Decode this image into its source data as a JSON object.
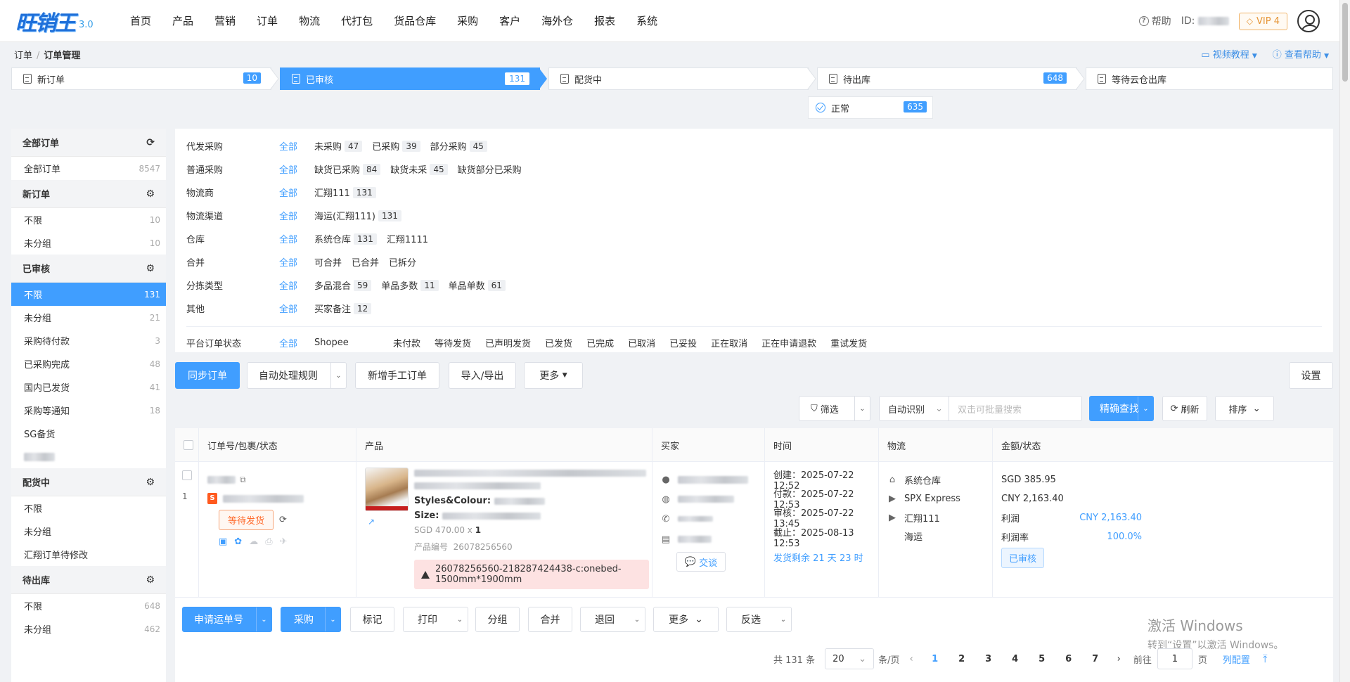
{
  "app": {
    "logo": "旺销王",
    "version": "3.0"
  },
  "nav": [
    "首页",
    "产品",
    "营销",
    "订单",
    "物流",
    "代打包",
    "货品仓库",
    "采购",
    "客户",
    "海外仓",
    "报表",
    "系统"
  ],
  "top_right": {
    "help": "帮助",
    "id_label": "ID:",
    "vip": "VIP 4"
  },
  "breadcrumb": {
    "parent": "订单",
    "current": "订单管理"
  },
  "bc_links": {
    "video": "视频教程",
    "help": "查看帮助"
  },
  "stages": [
    {
      "label": "新订单",
      "count": "10"
    },
    {
      "label": "已审核",
      "count": "131"
    },
    {
      "label": "配货中",
      "count": ""
    },
    {
      "label": "待出库",
      "count": "648"
    },
    {
      "label": "等待云仓出库",
      "count": ""
    }
  ],
  "sub_stage": {
    "label": "正常",
    "count": "635"
  },
  "sidebar": {
    "groups": [
      {
        "title": "全部订单",
        "icon": "refresh-icon",
        "items": [
          {
            "label": "全部订单",
            "count": "8547"
          }
        ]
      },
      {
        "title": "新订单",
        "icon": "gear-icon",
        "items": [
          {
            "label": "不限",
            "count": "10"
          },
          {
            "label": "未分组",
            "count": "10"
          }
        ]
      },
      {
        "title": "已审核",
        "icon": "gear-icon",
        "items": [
          {
            "label": "不限",
            "count": "131"
          },
          {
            "label": "未分组",
            "count": "21"
          },
          {
            "label": "采购待付款",
            "count": "3"
          },
          {
            "label": "已采购完成",
            "count": "48"
          },
          {
            "label": "国内已发货",
            "count": "41"
          },
          {
            "label": "采购等通知",
            "count": "18"
          },
          {
            "label": "SG备货",
            "count": ""
          }
        ]
      },
      {
        "title": "配货中",
        "icon": "gear-icon",
        "items": [
          {
            "label": "不限",
            "count": ""
          },
          {
            "label": "未分组",
            "count": ""
          },
          {
            "label": "汇翔订单待修改",
            "count": ""
          }
        ]
      },
      {
        "title": "待出库",
        "icon": "gear-icon",
        "items": [
          {
            "label": "不限",
            "count": "648"
          },
          {
            "label": "未分组",
            "count": "462"
          }
        ]
      }
    ]
  },
  "filters": {
    "all": "全部",
    "rows": [
      {
        "label": "代发采购",
        "opts": [
          {
            "t": "未采购",
            "c": "47"
          },
          {
            "t": "已采购",
            "c": "39"
          },
          {
            "t": "部分采购",
            "c": "45"
          }
        ]
      },
      {
        "label": "普通采购",
        "opts": [
          {
            "t": "缺货已采购",
            "c": "84"
          },
          {
            "t": "缺货未采",
            "c": "45"
          },
          {
            "t": "缺货部分已采购",
            "c": ""
          }
        ]
      },
      {
        "label": "物流商",
        "opts": [
          {
            "t": "汇翔111",
            "c": "131"
          }
        ]
      },
      {
        "label": "物流渠道",
        "opts": [
          {
            "t": "海运(汇翔111)",
            "c": "131"
          }
        ]
      },
      {
        "label": "仓库",
        "opts": [
          {
            "t": "系统仓库",
            "c": "131"
          },
          {
            "t": "汇翔1111",
            "c": ""
          }
        ]
      },
      {
        "label": "合并",
        "opts": [
          {
            "t": "可合并",
            "c": ""
          },
          {
            "t": "已合并",
            "c": ""
          },
          {
            "t": "已拆分",
            "c": ""
          }
        ]
      },
      {
        "label": "分拣类型",
        "opts": [
          {
            "t": "多品混合",
            "c": "59"
          },
          {
            "t": "单品多数",
            "c": "11"
          },
          {
            "t": "单品单数",
            "c": "61"
          }
        ]
      },
      {
        "label": "其他",
        "opts": [
          {
            "t": "买家备注",
            "c": "12"
          }
        ]
      }
    ],
    "platform": {
      "label": "平台订单状态",
      "platform": "Shopee",
      "opts": [
        "未付款",
        "等待发货",
        "已声明发货",
        "已发货",
        "已完成",
        "已取消",
        "已妥投",
        "正在取消",
        "正在申请退款",
        "重试发货"
      ]
    }
  },
  "actions": {
    "sync": "同步订单",
    "rules": "自动处理规则",
    "manual": "新增手工订单",
    "io": "导入/导出",
    "more": "更多",
    "settings": "设置"
  },
  "search": {
    "filter": "筛选",
    "auto": "自动识别",
    "placeholder": "双击可批量搜索",
    "exact": "精确查找",
    "refresh": "刷新",
    "sort": "排序"
  },
  "table": {
    "headers": [
      "订单号/包裹/状态",
      "产品",
      "买家",
      "时间",
      "物流",
      "金额/状态"
    ],
    "row": {
      "index": "1",
      "status": "等待发货",
      "product": {
        "attr1_label": "Styles&Colour:",
        "attr2_label": "Size:",
        "price": "SGD 470.00 x",
        "qty": "1",
        "code_label": "产品编号",
        "code": "26078256560",
        "warning": "26078256560-218287424438-c:onebed-1500mm*1900mm"
      },
      "buyer": {
        "chat": "交谈"
      },
      "time": {
        "created": "创建：2025-07-22 12:52",
        "paid": "付款：2025-07-22 12:53",
        "audited": "审核：2025-07-22 13:45",
        "deadline": "截止：2025-08-13 12:53",
        "remain": "发货剩余 21 天 23 时"
      },
      "logistics": {
        "warehouse": "系统仓库",
        "carrier": "SPX Express",
        "forwarder": "汇翔111",
        "mode": "海运"
      },
      "amount": {
        "sgd": "SGD 385.95",
        "cny": "CNY 2,163.40",
        "profit_label": "利润",
        "profit": "CNY 2,163.40",
        "rate_label": "利润率",
        "rate": "100.0%",
        "status": "已审核"
      }
    }
  },
  "bottom": {
    "apply": "申请运单号",
    "purchase": "采购",
    "mark": "标记",
    "print": "打印",
    "group": "分组",
    "merge": "合并",
    "back": "退回",
    "more": "更多",
    "invert": "反选"
  },
  "pager": {
    "total": "共 131 条",
    "size": "20",
    "per": "条/页",
    "pages": [
      "1",
      "2",
      "3",
      "4",
      "5",
      "6",
      "7"
    ],
    "goto": "前往",
    "page_input": "1",
    "page_unit": "页",
    "cols": "列配置"
  },
  "watermark": {
    "line1": "激活 Windows",
    "line2": "转到“设置”以激活 Windows。"
  },
  "colors": {
    "primary": "#409eff",
    "orange": "#ff6a2b"
  }
}
